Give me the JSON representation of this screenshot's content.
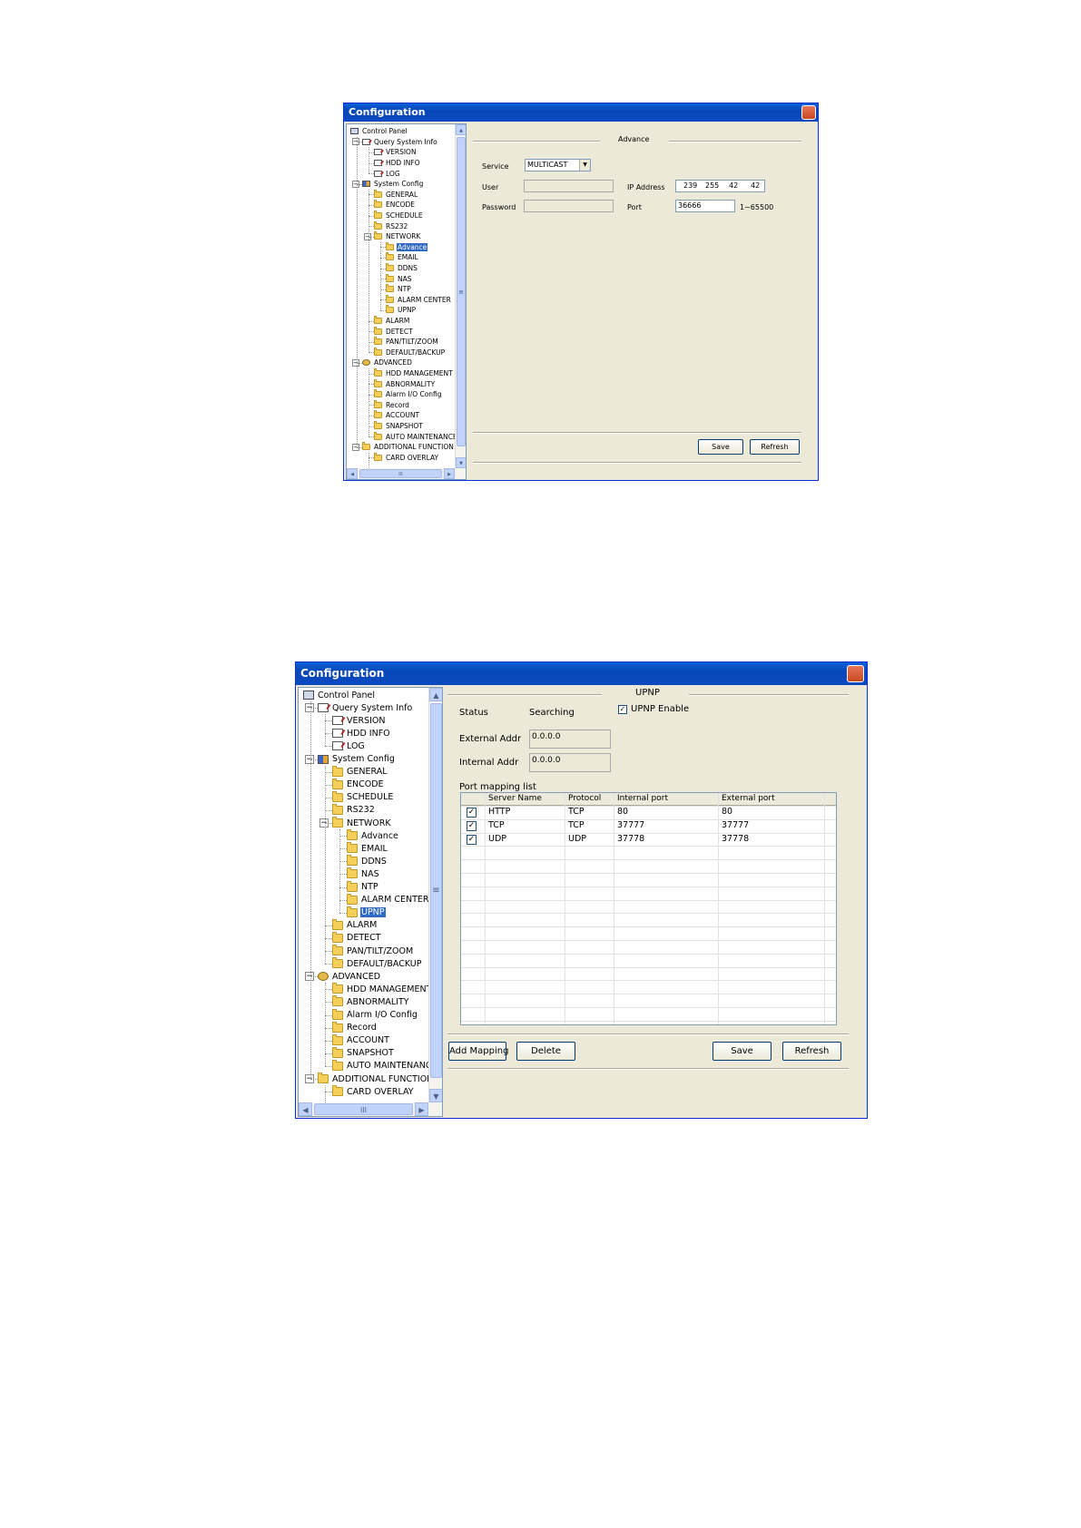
{
  "window1": {
    "title": "Configuration",
    "tree": [
      {
        "label": "Control Panel",
        "icon": "computer-icon"
      },
      {
        "label": "Query System Info",
        "icon": "edit-doc-icon"
      },
      {
        "label": "VERSION",
        "icon": "edit-doc-icon"
      },
      {
        "label": "HDD INFO",
        "icon": "edit-doc-icon"
      },
      {
        "label": "LOG",
        "icon": "edit-doc-icon"
      },
      {
        "label": "System Config",
        "icon": "system-icon"
      },
      {
        "label": "GENERAL",
        "icon": "folder-icon"
      },
      {
        "label": "ENCODE",
        "icon": "folder-icon"
      },
      {
        "label": "SCHEDULE",
        "icon": "folder-icon"
      },
      {
        "label": "RS232",
        "icon": "folder-icon"
      },
      {
        "label": "NETWORK",
        "icon": "folder-icon"
      },
      {
        "label": "Advance",
        "icon": "folder-icon"
      },
      {
        "label": "EMAIL",
        "icon": "folder-icon"
      },
      {
        "label": "DDNS",
        "icon": "folder-icon"
      },
      {
        "label": "NAS",
        "icon": "folder-icon"
      },
      {
        "label": "NTP",
        "icon": "folder-icon"
      },
      {
        "label": "ALARM CENTER",
        "icon": "folder-icon"
      },
      {
        "label": "UPNP",
        "icon": "folder-icon"
      },
      {
        "label": "ALARM",
        "icon": "folder-icon"
      },
      {
        "label": "DETECT",
        "icon": "folder-icon"
      },
      {
        "label": "PAN/TILT/ZOOM",
        "icon": "folder-icon"
      },
      {
        "label": "DEFAULT/BACKUP",
        "icon": "folder-icon"
      },
      {
        "label": "ADVANCED",
        "icon": "gear-icon"
      },
      {
        "label": "HDD MANAGEMENT",
        "icon": "folder-icon"
      },
      {
        "label": "ABNORMALITY",
        "icon": "folder-icon"
      },
      {
        "label": "Alarm I/O Config",
        "icon": "folder-icon"
      },
      {
        "label": "Record",
        "icon": "folder-icon"
      },
      {
        "label": "ACCOUNT",
        "icon": "folder-icon"
      },
      {
        "label": "SNAPSHOT",
        "icon": "folder-icon"
      },
      {
        "label": "AUTO MAINTENANCE",
        "icon": "folder-icon"
      },
      {
        "label": "ADDITIONAL FUNCTION",
        "icon": "folder-icon"
      },
      {
        "label": "CARD OVERLAY",
        "icon": "folder-icon"
      }
    ],
    "selected_item": "Advance",
    "panel": {
      "section_title": "Advance",
      "service_label": "Service",
      "service_value": "MULTICAST",
      "user_label": "User",
      "user_value": "",
      "password_label": "Password",
      "password_value": "",
      "ip_label": "IP Address",
      "ip_octets": [
        "239",
        "255",
        "42",
        "42"
      ],
      "port_label": "Port",
      "port_value": "36666",
      "port_range": "1~65500",
      "save_label": "Save",
      "refresh_label": "Refresh"
    }
  },
  "window2": {
    "title": "Configuration",
    "selected_item": "UPNP",
    "panel": {
      "section_title": "UPNP",
      "status_label": "Status",
      "status_value": "Searching",
      "upnp_enable_label": "UPNP Enable",
      "upnp_enabled": true,
      "external_addr_label": "External Addr",
      "external_addr_value": "0.0.0.0",
      "internal_addr_label": "Internal Addr",
      "internal_addr_value": "0.0.0.0",
      "port_mapping_label": "Port mapping list",
      "columns": [
        "Server Name",
        "Protocol",
        "Internal port",
        "External port"
      ],
      "rows": [
        {
          "checked": true,
          "server": "HTTP",
          "protocol": "TCP",
          "internal": "80",
          "external": "80"
        },
        {
          "checked": true,
          "server": "TCP",
          "protocol": "TCP",
          "internal": "37777",
          "external": "37777"
        },
        {
          "checked": true,
          "server": "UDP",
          "protocol": "UDP",
          "internal": "37778",
          "external": "37778"
        }
      ],
      "add_mapping_label": "Add Mapping",
      "delete_label": "Delete",
      "save_label": "Save",
      "refresh_label": "Refresh"
    }
  },
  "scroll": {
    "up": "▲",
    "down": "▼",
    "left": "◀",
    "right": "▶",
    "grip": "≡",
    "hgrip": "III"
  },
  "colors": {
    "titlebar": "#0a54cc",
    "selection": "#316ac5",
    "window_bg": "#ece9d8"
  }
}
